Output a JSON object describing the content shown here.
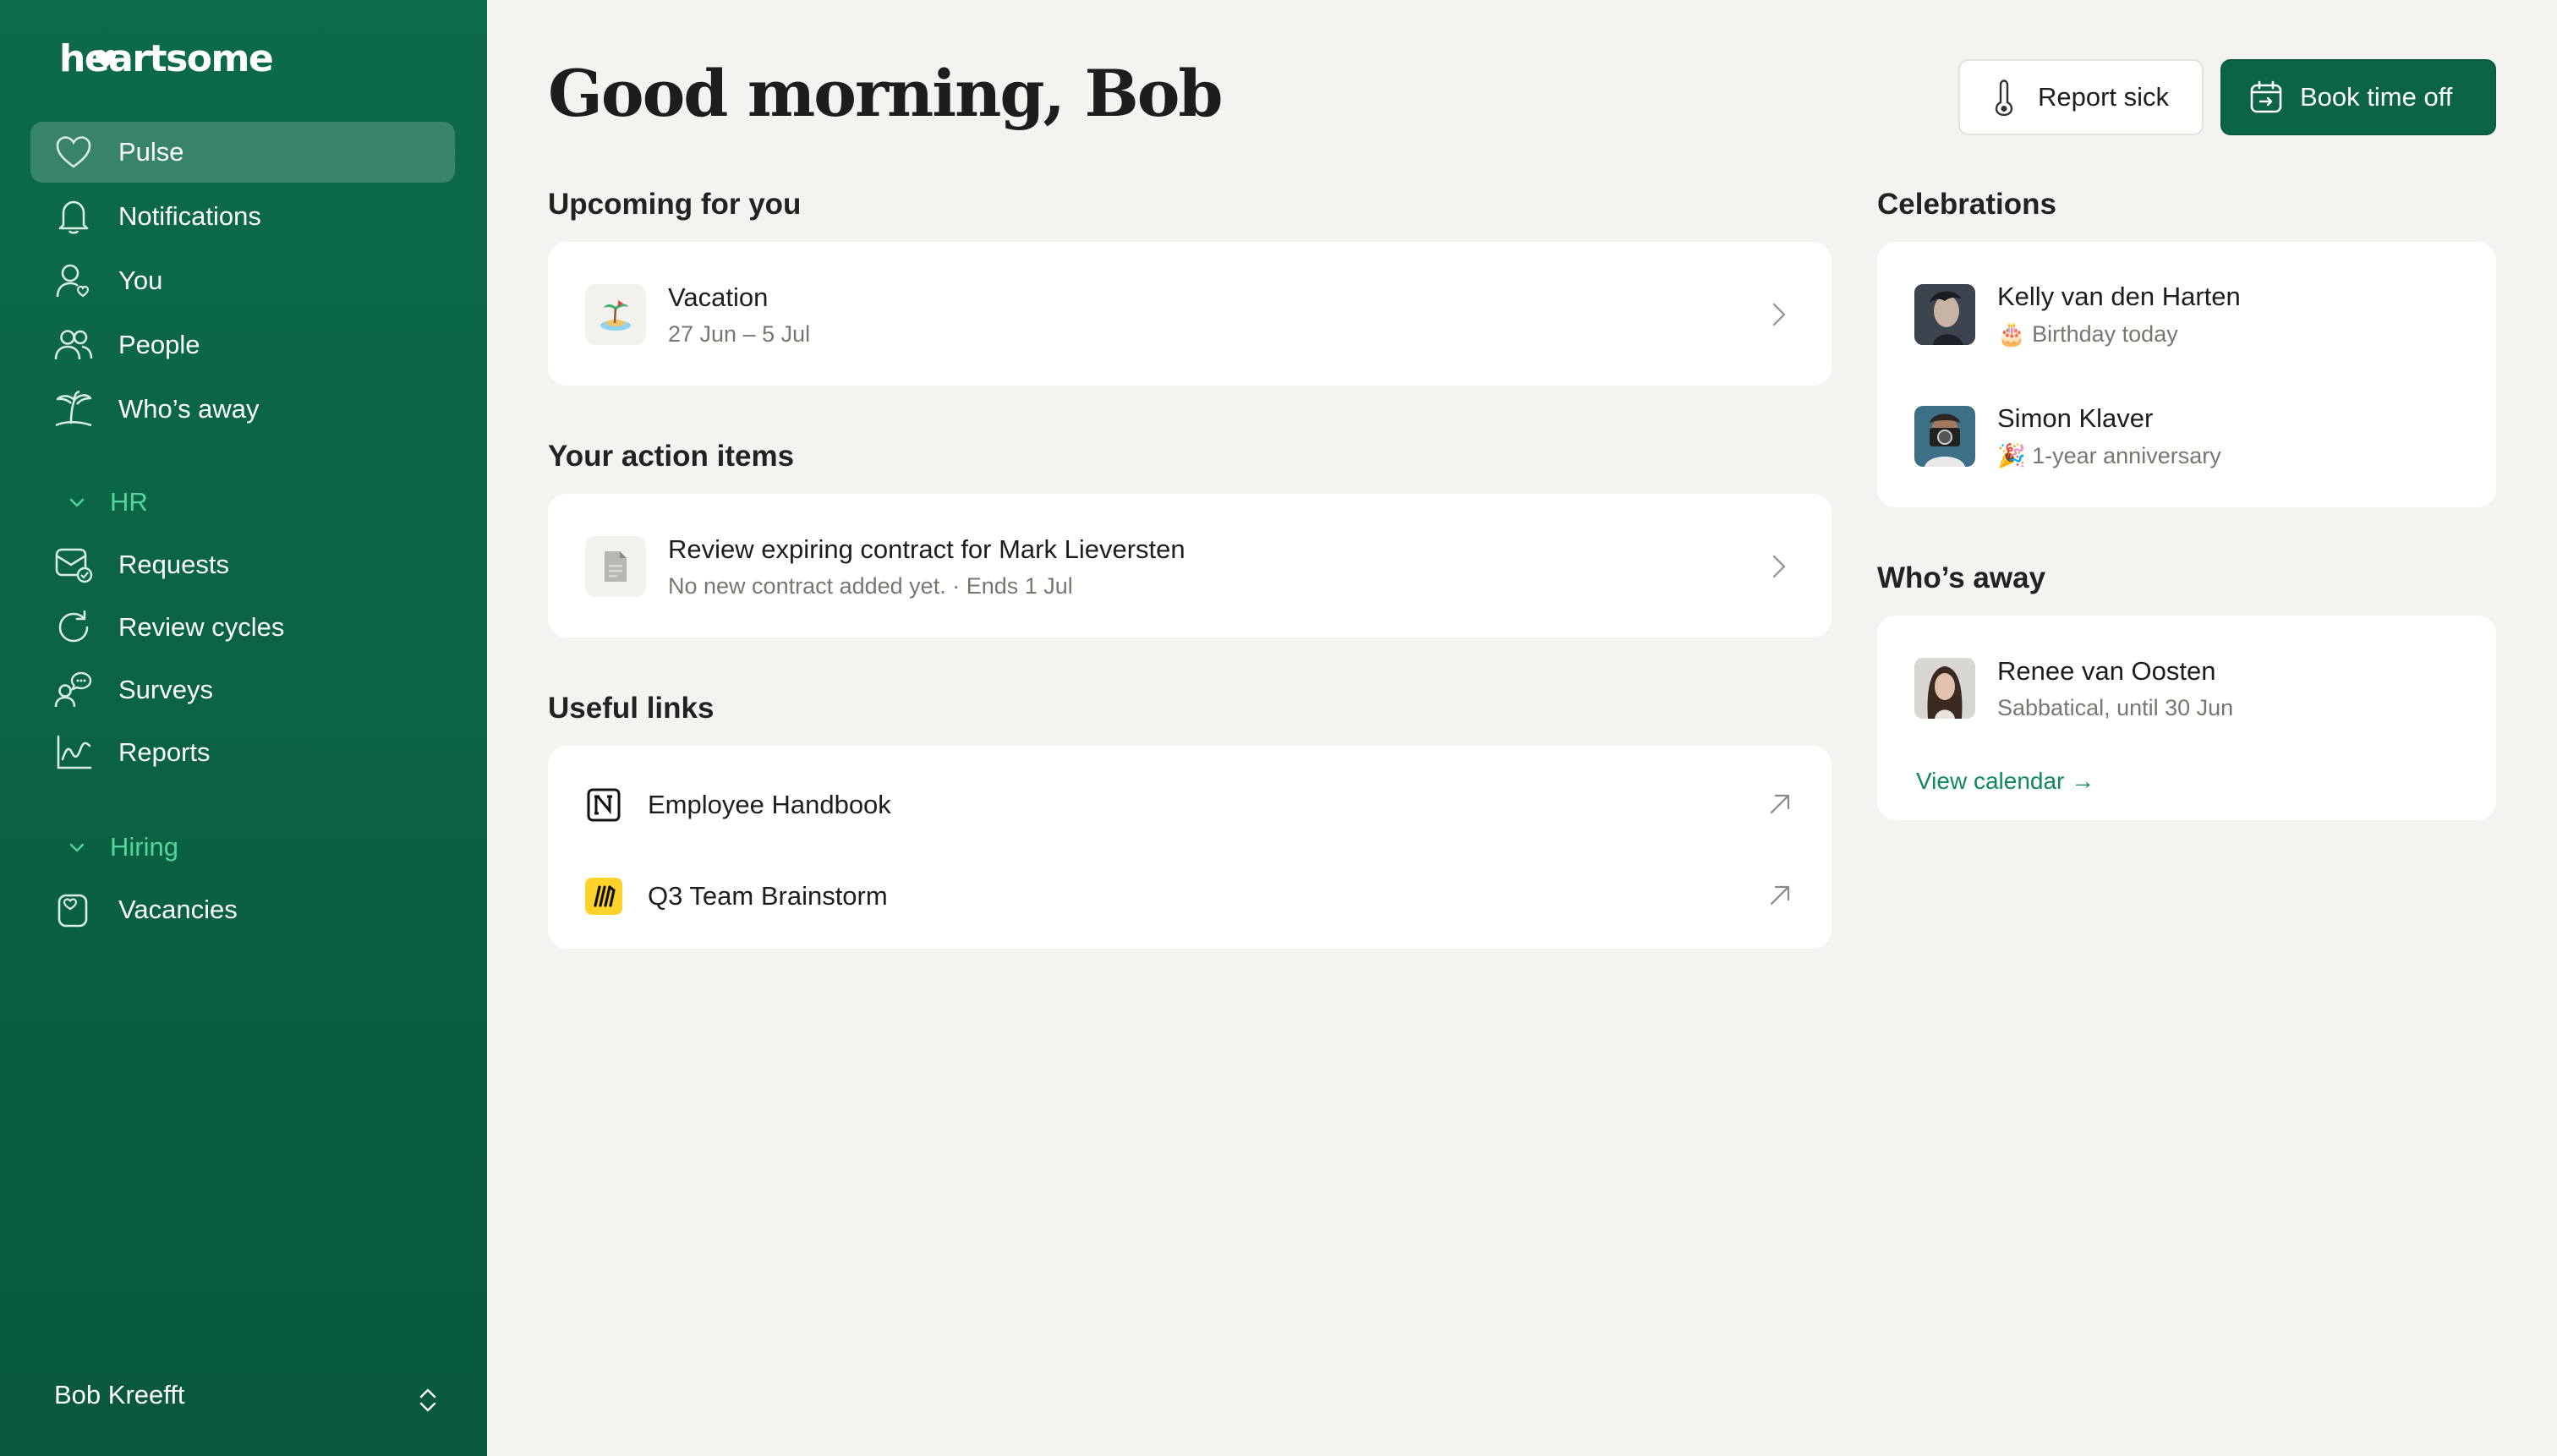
{
  "sidebar": {
    "logo_text": "heartsome",
    "items": [
      {
        "label": "Pulse",
        "icon": "heart-icon"
      },
      {
        "label": "Notifications",
        "icon": "bell-icon"
      },
      {
        "label": "You",
        "icon": "user-icon"
      },
      {
        "label": "People",
        "icon": "people-icon"
      },
      {
        "label": "Who’s away",
        "icon": "palm-tree-icon"
      }
    ],
    "hr_section": {
      "label": "HR",
      "items": [
        {
          "label": "Requests",
          "icon": "mail-check-icon"
        },
        {
          "label": "Review cycles",
          "icon": "refresh-icon"
        },
        {
          "label": "Surveys",
          "icon": "survey-icon"
        },
        {
          "label": "Reports",
          "icon": "chart-icon"
        }
      ]
    },
    "hiring_section": {
      "label": "Hiring",
      "items": [
        {
          "label": "Vacancies",
          "icon": "vacancy-icon"
        }
      ]
    },
    "user_name": "Bob Kreefft"
  },
  "header": {
    "greeting": "Good morning, Bob",
    "report_sick_label": "Report sick",
    "book_time_off_label": "Book time off"
  },
  "upcoming": {
    "title": "Upcoming for you",
    "items": [
      {
        "title": "Vacation",
        "subtitle": "27 Jun – 5 Jul",
        "icon": "island-emoji"
      }
    ]
  },
  "action_items": {
    "title": "Your action items",
    "items": [
      {
        "title": "Review expiring contract for Mark Lieversten",
        "subtitle": "No new contract added yet. · Ends 1 Jul",
        "icon": "document-icon"
      }
    ]
  },
  "useful_links": {
    "title": "Useful links",
    "items": [
      {
        "label": "Employee Handbook",
        "icon": "notion-icon"
      },
      {
        "label": "Q3 Team Brainstorm",
        "icon": "miro-icon"
      }
    ]
  },
  "celebrations": {
    "title": "Celebrations",
    "items": [
      {
        "name": "Kelly van den Harten",
        "detail": "🎂 Birthday today"
      },
      {
        "name": "Simon Klaver",
        "detail": "🎉 1-year anniversary"
      }
    ]
  },
  "whos_away": {
    "title": "Who’s away",
    "items": [
      {
        "name": "Renee van Oosten",
        "detail": "Sabbatical, until 30 Jun"
      }
    ],
    "view_calendar_label": "View calendar →"
  },
  "colors": {
    "sidebar_green": "#0c6b4a",
    "accent_green": "#55d59a",
    "primary_button": "#0b6545",
    "background": "#f4f3ef"
  }
}
